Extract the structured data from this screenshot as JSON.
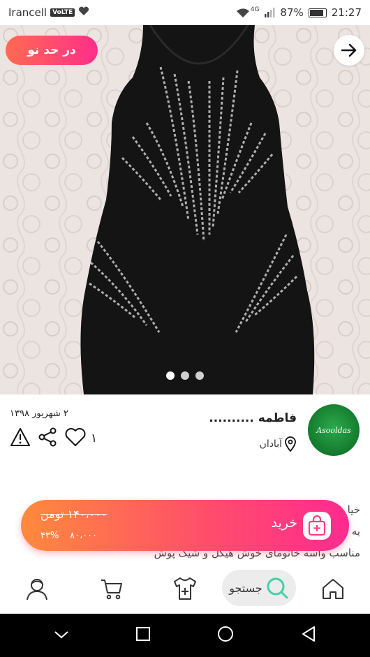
{
  "status_bar": {
    "carrier": "Irancell",
    "volte": "VoLTE",
    "network": "4G",
    "battery": "87%",
    "time": "21:27"
  },
  "hero": {
    "condition_tag": "در حد نو",
    "carousel_dots": 3,
    "active_dot": 0
  },
  "product": {
    "date": "۲ شهریور ۱۳۹۸",
    "like_count": "۱",
    "seller_name": "فاطمه ..........",
    "location": "آبادان",
    "avatar_text": "Asooldas"
  },
  "description": {
    "line1": "خیا",
    "line2": "یه",
    "line3": "مناسب واسه خانومای خوش هیکل و شیک پوش"
  },
  "buy_bar": {
    "old_price": "۱۴۰،۰۰۰ تومن",
    "new_price": "۸۰،۰۰۰",
    "discount": "۴۳%",
    "buy_label": "خرید"
  },
  "bottom_nav": {
    "search_label": "جستجو"
  },
  "colors": {
    "accent_start": "#ff8a3c",
    "accent_end": "#ff2a8f",
    "search_icon": "#3fd1a8"
  }
}
